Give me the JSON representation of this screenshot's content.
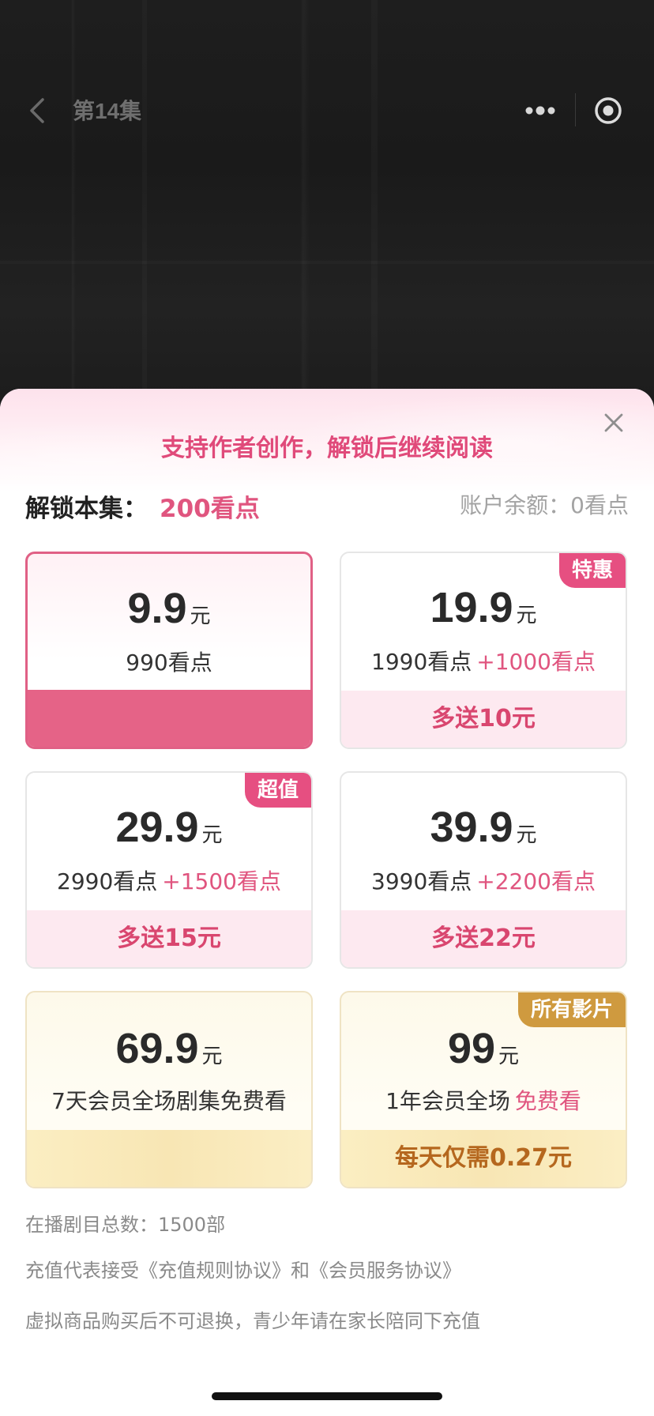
{
  "topbar": {
    "episode_title": "第14集",
    "icons": [
      "back-chevron-icon",
      "more-dots-icon",
      "target-icon"
    ]
  },
  "sheet": {
    "title": "支持作者创作，解锁后继续阅读",
    "unlock_label": "解锁本集：",
    "unlock_cost": "200看点",
    "balance": "账户余额：0看点"
  },
  "plans": [
    {
      "price": "9.9",
      "unit": "元",
      "points": "990看点",
      "bonus": "",
      "footer": "",
      "badge": "",
      "selected": true,
      "style": "pink"
    },
    {
      "price": "19.9",
      "unit": "元",
      "points": "1990看点",
      "bonus": "+1000看点",
      "footer": "多送10元",
      "badge": "特惠",
      "selected": false,
      "style": "pink"
    },
    {
      "price": "29.9",
      "unit": "元",
      "points": "2990看点",
      "bonus": "+1500看点",
      "footer": "多送15元",
      "badge": "超值",
      "selected": false,
      "style": "pink"
    },
    {
      "price": "39.9",
      "unit": "元",
      "points": "3990看点",
      "bonus": "+2200看点",
      "footer": "多送22元",
      "badge": "",
      "selected": false,
      "style": "pink"
    },
    {
      "price": "69.9",
      "unit": "元",
      "points": "7天会员全场剧集免费看",
      "bonus": "",
      "footer": "",
      "badge": "",
      "selected": false,
      "style": "gold"
    },
    {
      "price": "99",
      "unit": "元",
      "points": "1年会员全场",
      "bonus": "免费看",
      "footer": "每天仅需0.27元",
      "badge": "所有影片",
      "selected": false,
      "style": "gold"
    }
  ],
  "notes": {
    "total": "在播剧目总数：1500部",
    "agreement": "充值代表接受《充值规则协议》和《会员服务协议》",
    "disclaimer": "虚拟商品购买后不可退换，青少年请在家长陪同下充值"
  },
  "colors": {
    "accent_pink": "#e0557f",
    "selected_pink": "#e56387",
    "gold_text": "#b5671e",
    "gold_badge": "#cf9a3f"
  }
}
